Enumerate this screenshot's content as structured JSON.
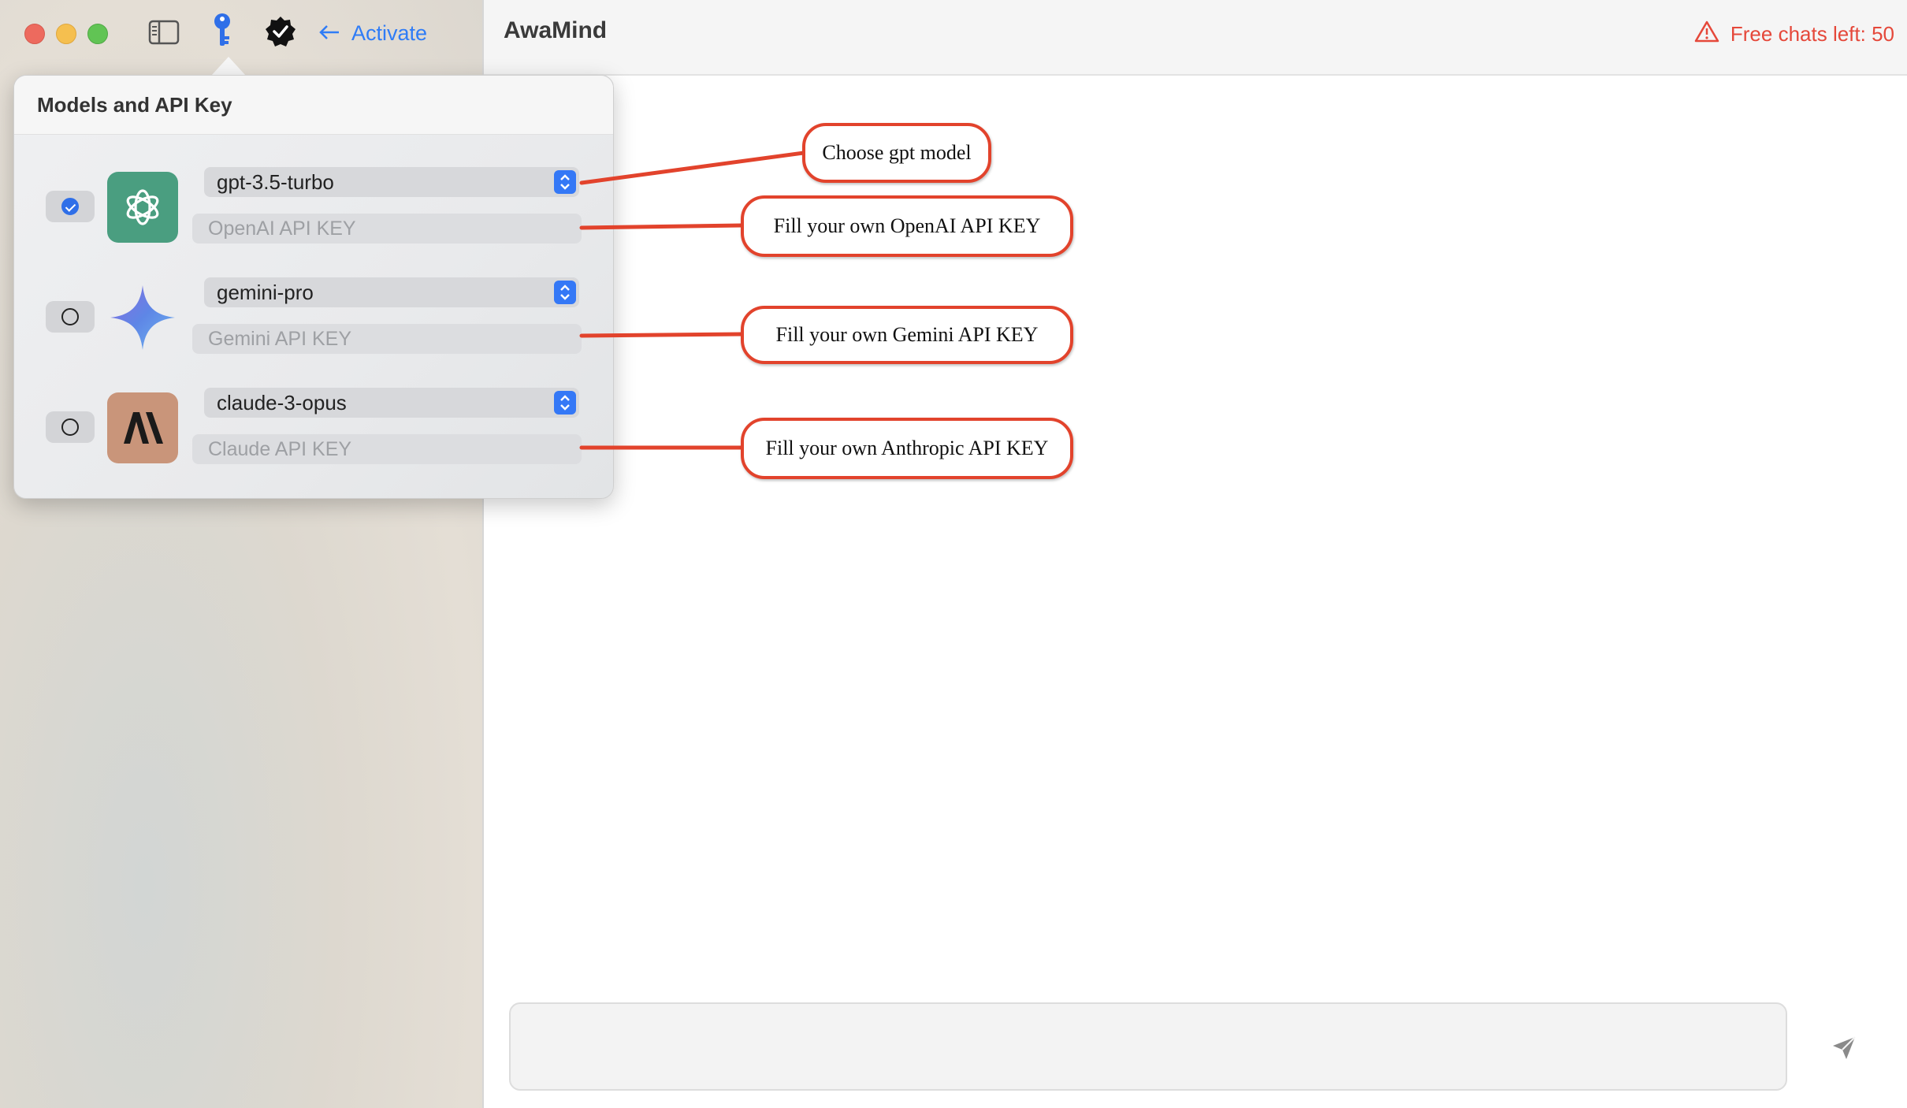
{
  "toolbar": {
    "activate_label": "Activate"
  },
  "header": {
    "app_title": "AwaMind",
    "free_chats": "Free chats left: 50"
  },
  "popover": {
    "title": "Models and API Key",
    "rows": [
      {
        "selected": true,
        "model": "gpt-3.5-turbo",
        "key_placeholder": "OpenAI API KEY",
        "key_value": "",
        "logo": "openai-logo"
      },
      {
        "selected": false,
        "model": "gemini-pro",
        "key_placeholder": "Gemini API KEY",
        "key_value": "",
        "logo": "gemini-logo"
      },
      {
        "selected": false,
        "model": "claude-3-opus",
        "key_placeholder": "Claude API KEY",
        "key_value": "",
        "logo": "anthropic-logo"
      }
    ]
  },
  "annotations": {
    "choose_model": "Choose gpt model",
    "openai_key": "Fill your own OpenAI API KEY",
    "gemini_key": "Fill your own Gemini API KEY",
    "anthropic_key": "Fill your own Anthropic API KEY"
  },
  "chat": {
    "input_value": "",
    "input_placeholder": ""
  },
  "colors": {
    "accent": "#2f7cf6",
    "warning": "#e5483a",
    "annotation_border": "#e2432c",
    "openai_green": "#4a9e80",
    "anthropic_tan": "#c9957a"
  },
  "icons": [
    "sidebar-toggle-icon",
    "key-icon",
    "verified-badge-icon",
    "arrow-left-icon",
    "warning-icon",
    "send-icon",
    "chevron-up-down-icon"
  ]
}
